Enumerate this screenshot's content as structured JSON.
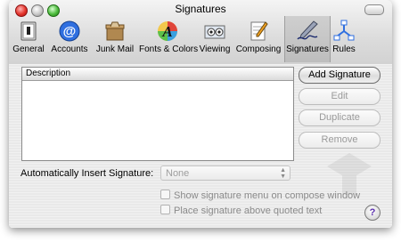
{
  "window": {
    "title": "Signatures"
  },
  "toolbar": {
    "items": [
      {
        "label": "General",
        "icon": "general-icon"
      },
      {
        "label": "Accounts",
        "icon": "accounts-icon"
      },
      {
        "label": "Junk Mail",
        "icon": "junk-mail-icon"
      },
      {
        "label": "Fonts & Colors",
        "icon": "fonts-colors-icon"
      },
      {
        "label": "Viewing",
        "icon": "viewing-icon"
      },
      {
        "label": "Composing",
        "icon": "composing-icon"
      },
      {
        "label": "Signatures",
        "icon": "signatures-icon",
        "selected": true
      },
      {
        "label": "Rules",
        "icon": "rules-icon"
      }
    ]
  },
  "list": {
    "header": "Description"
  },
  "buttons": {
    "add": "Add Signature",
    "edit": "Edit",
    "duplicate": "Duplicate",
    "remove": "Remove"
  },
  "auto_insert": {
    "label": "Automatically Insert Signature:",
    "value": "None"
  },
  "options": {
    "show_menu": "Show signature menu on compose window",
    "place_above": "Place signature above quoted text"
  },
  "help": {
    "label": "?"
  }
}
